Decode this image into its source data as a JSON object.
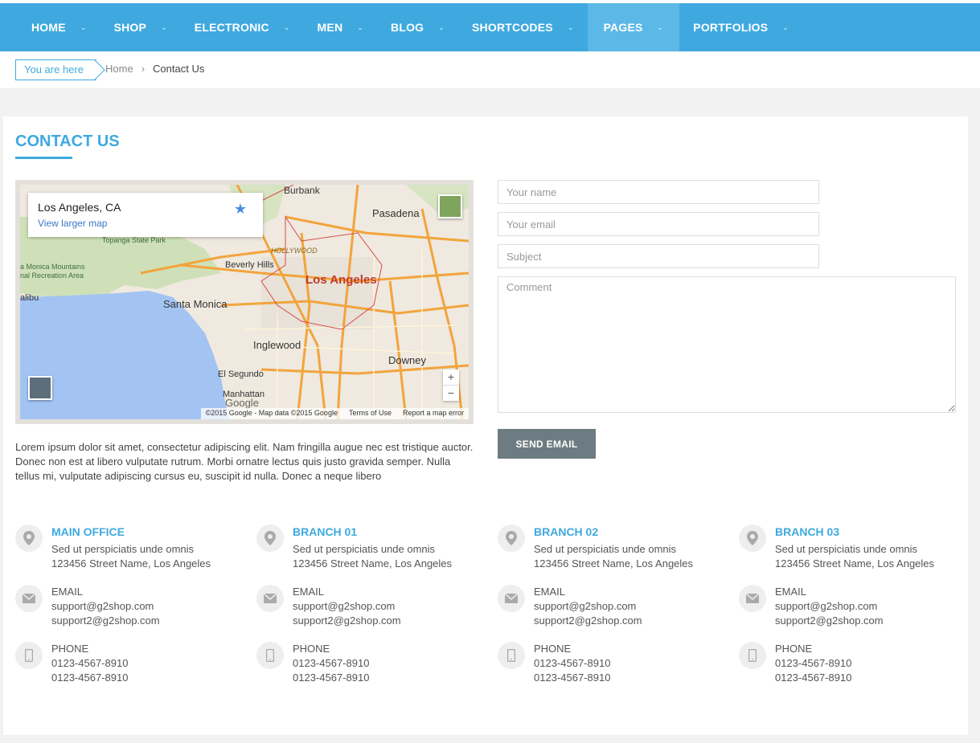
{
  "nav": {
    "items": [
      {
        "label": "HOME"
      },
      {
        "label": "SHOP"
      },
      {
        "label": "ELECTRONIC"
      },
      {
        "label": "MEN"
      },
      {
        "label": "BLOG"
      },
      {
        "label": "SHORTCODES"
      },
      {
        "label": "PAGES"
      },
      {
        "label": "PORTFOLIOS"
      }
    ],
    "active": "PAGES",
    "color": "#3fa9df"
  },
  "breadcrumb": {
    "you_are_here": "You are here",
    "home": "Home",
    "separator": "›",
    "current": "Contact Us"
  },
  "page": {
    "title": "CONTACT US",
    "description": "Lorem ipsum dolor sit amet, consectetur adipiscing elit. Nam fringilla augue nec est tristique auctor. Donec non est at libero vulputate rutrum. Morbi ornatre lectus quis justo gravida semper. Nulla tellus mi, vulputate adipiscing cursus eu, suscipit id nulla. Donec a neque libero"
  },
  "map": {
    "place": "Los Angeles, CA",
    "larger_link": "View larger map",
    "labels": {
      "burbank": "Burbank",
      "pasadena": "Pasadena",
      "topanga": "Topanga State Park",
      "hollywood": "HOLLYWOOD",
      "beverly": "Beverly Hills",
      "la": "Los Angeles",
      "monica_mtn": "a Monica Mountains",
      "recreation": "nal Recreation Area",
      "malibu": "alibu",
      "santa_monica": "Santa Monica",
      "inglewood": "Inglewood",
      "downey": "Downey",
      "el_segundo": "El Segundo",
      "manhattan": "Manhattan",
      "google": "Google"
    },
    "zoom_in": "+",
    "zoom_out": "−",
    "footer": {
      "copyright": "©2015 Google - Map data ©2015 Google",
      "terms": "Terms of Use",
      "report": "Report a map error"
    }
  },
  "form": {
    "name_placeholder": "Your name",
    "email_placeholder": "Your email",
    "subject_placeholder": "Subject",
    "comment_placeholder": "Comment",
    "send_label": "SEND EMAIL"
  },
  "offices": [
    {
      "title": "MAIN OFFICE",
      "line1": "Sed ut perspiciatis unde omnis",
      "line2": "123456 Street Name, Los Angeles",
      "email_label": "EMAIL",
      "email1": "support@g2shop.com",
      "email2": "support2@g2shop.com",
      "phone_label": "PHONE",
      "phone1": "0123-4567-8910",
      "phone2": "0123-4567-8910"
    },
    {
      "title": "BRANCH 01",
      "line1": "Sed ut perspiciatis unde omnis",
      "line2": "123456 Street Name, Los Angeles",
      "email_label": "EMAIL",
      "email1": "support@g2shop.com",
      "email2": "support2@g2shop.com",
      "phone_label": "PHONE",
      "phone1": "0123-4567-8910",
      "phone2": "0123-4567-8910"
    },
    {
      "title": "BRANCH 02",
      "line1": "Sed ut perspiciatis unde omnis",
      "line2": "123456 Street Name, Los Angeles",
      "email_label": "EMAIL",
      "email1": "support@g2shop.com",
      "email2": "support2@g2shop.com",
      "phone_label": "PHONE",
      "phone1": "0123-4567-8910",
      "phone2": "0123-4567-8910"
    },
    {
      "title": "BRANCH 03",
      "line1": "Sed ut perspiciatis unde omnis",
      "line2": "123456 Street Name, Los Angeles",
      "email_label": "EMAIL",
      "email1": "support@g2shop.com",
      "email2": "support2@g2shop.com",
      "phone_label": "PHONE",
      "phone1": "0123-4567-8910",
      "phone2": "0123-4567-8910"
    }
  ],
  "icons": {
    "location": "map-pin-icon",
    "email": "envelope-icon",
    "phone": "mobile-phone-icon"
  }
}
